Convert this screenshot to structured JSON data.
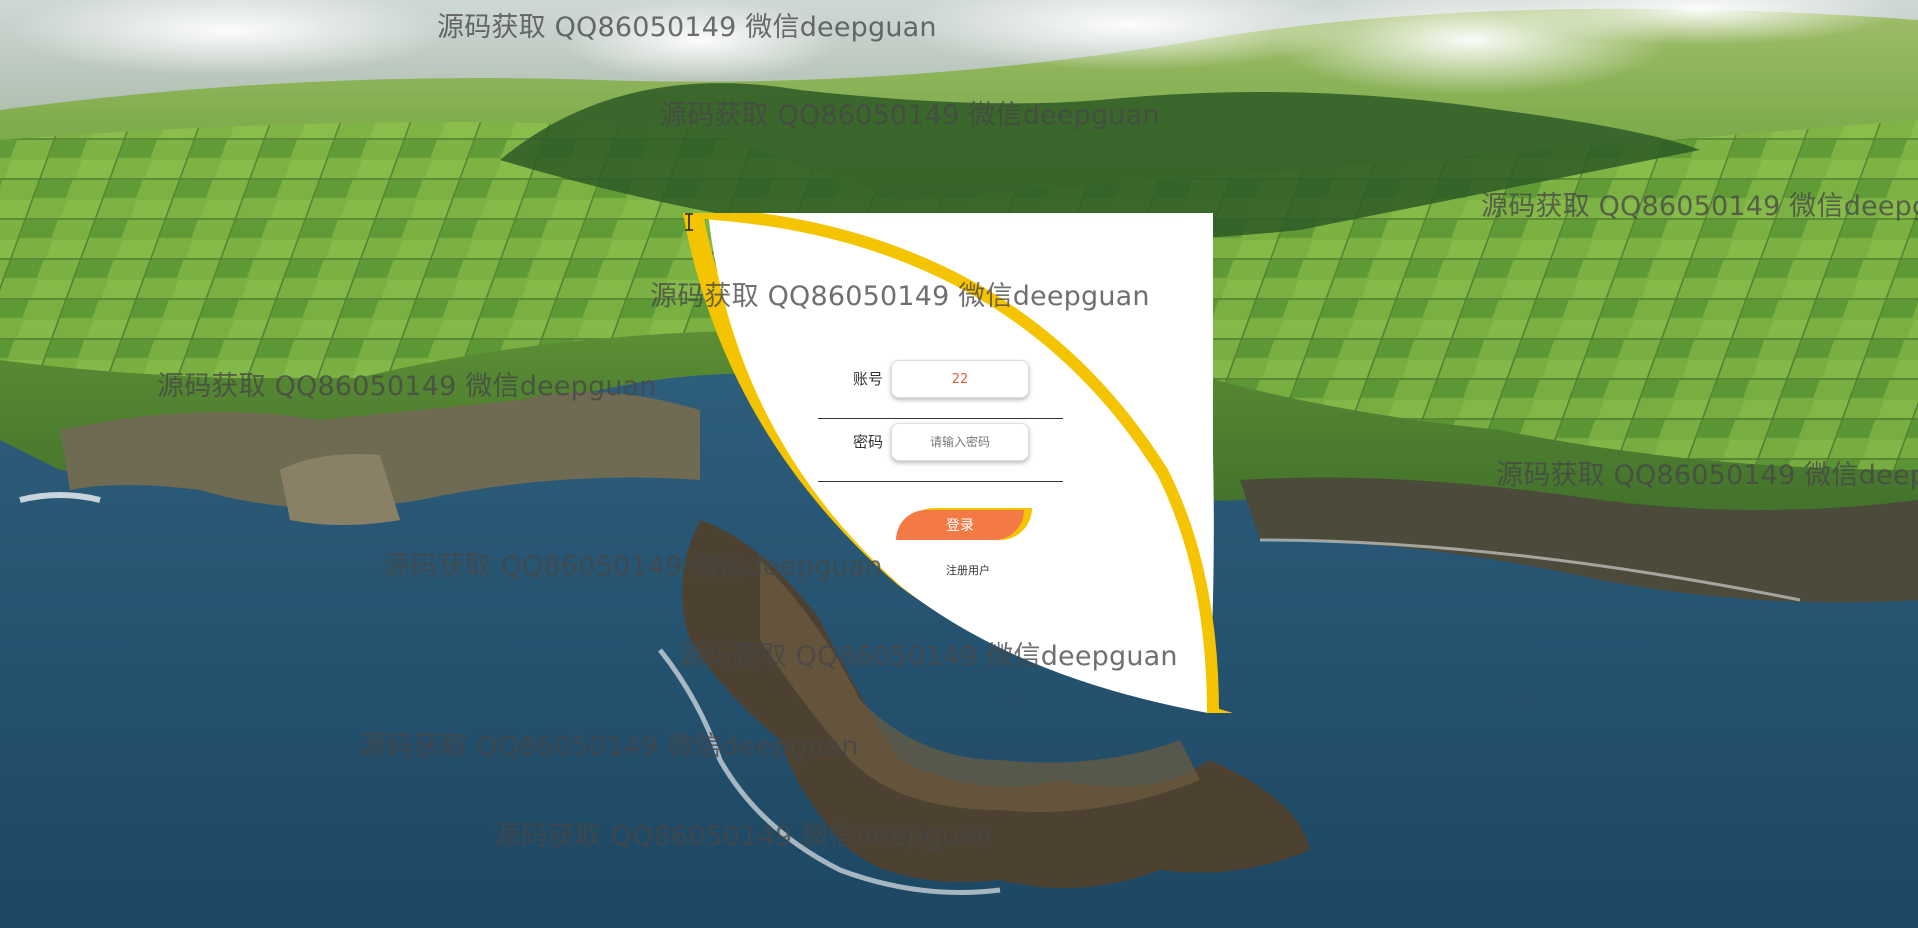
{
  "watermark_text": "源码获取 QQ86050149 微信deepguan",
  "login": {
    "account_label": "账号",
    "account_value": "22",
    "password_label": "密码",
    "password_placeholder": "请输入密码",
    "login_button_label": "登录",
    "register_link_label": "注册用户"
  },
  "colors": {
    "panel_bg": "#ffffff",
    "panel_accent": "#f5c400",
    "button": "#f47a45",
    "input_text": "#e0623a"
  },
  "icons": [
    "text-cursor-icon"
  ]
}
